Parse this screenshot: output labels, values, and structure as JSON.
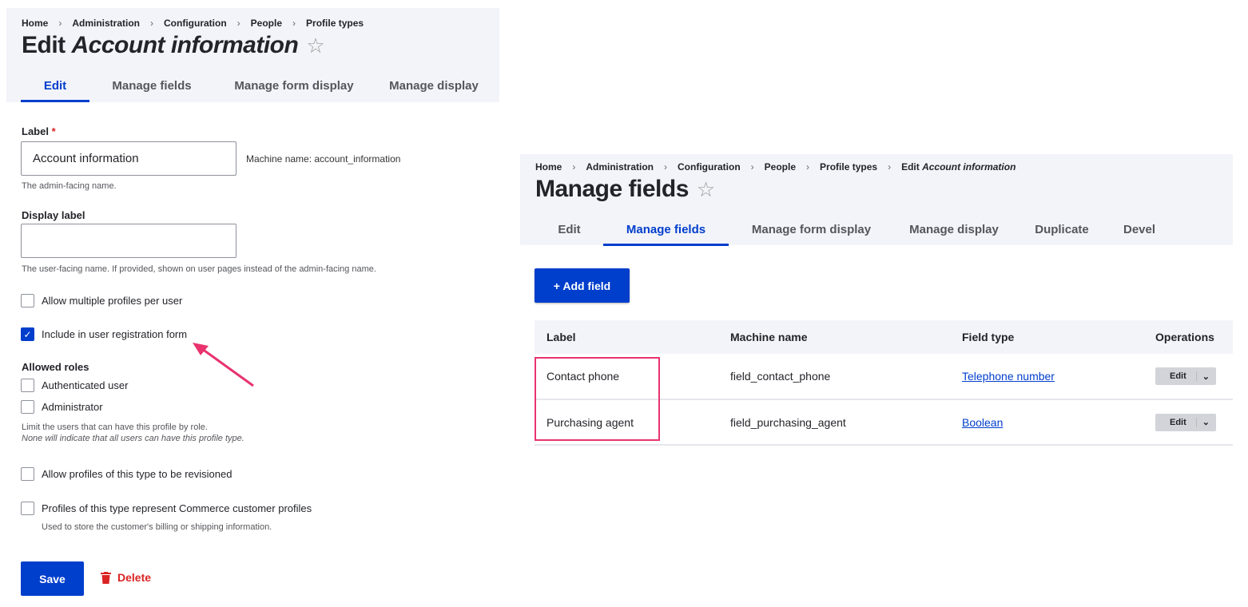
{
  "left": {
    "breadcrumb": [
      "Home",
      "Administration",
      "Configuration",
      "People",
      "Profile types"
    ],
    "title_prefix": "Edit",
    "title_em": "Account information",
    "star": "☆",
    "tabs": [
      "Edit",
      "Manage fields",
      "Manage form display",
      "Manage display"
    ],
    "label_label": "Label",
    "required": "*",
    "label_value": "Account information",
    "machine_name": "Machine name: account_information",
    "label_desc": "The admin-facing name.",
    "display_label": "Display label",
    "display_value": "",
    "display_desc": "The user-facing name. If provided, shown on user pages instead of the admin-facing name.",
    "allow_multiple": "Allow multiple profiles per user",
    "include_registration": "Include in user registration form",
    "allowed_roles": "Allowed roles",
    "role_auth": "Authenticated user",
    "role_admin": "Administrator",
    "roles_desc1": "Limit the users that can have this profile by role.",
    "roles_desc2": "None will indicate that all users can have this profile type.",
    "revisioned": "Allow profiles of this type to be revisioned",
    "commerce": "Profiles of this type represent Commerce customer profiles",
    "commerce_desc": "Used to store the customer's billing or shipping information.",
    "save": "Save",
    "delete": "Delete"
  },
  "right": {
    "breadcrumb": [
      "Home",
      "Administration",
      "Configuration",
      "People",
      "Profile types"
    ],
    "crumb_last_prefix": "Edit",
    "crumb_last_em": "Account information",
    "title": "Manage fields",
    "star": "☆",
    "tabs": [
      "Edit",
      "Manage fields",
      "Manage form display",
      "Manage display",
      "Duplicate",
      "Devel"
    ],
    "add_field": "+ Add field",
    "columns": [
      "Label",
      "Machine name",
      "Field type",
      "Operations"
    ],
    "rows": [
      {
        "label": "Contact phone",
        "machine": "field_contact_phone",
        "type": "Telephone number",
        "op": "Edit"
      },
      {
        "label": "Purchasing agent",
        "machine": "field_purchasing_agent",
        "type": "Boolean",
        "op": "Edit"
      }
    ]
  },
  "colors": {
    "accent": "#003ecc",
    "highlight": "#e8336f",
    "delete": "#dc2323"
  }
}
